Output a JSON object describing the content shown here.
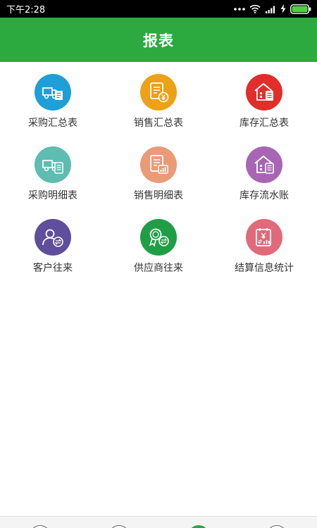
{
  "status_bar": {
    "time": "下午2:28",
    "icons": [
      "more-dots-icon",
      "wifi-icon",
      "signal-icon",
      "charging-icon",
      "battery-icon"
    ]
  },
  "header": {
    "title": "报表"
  },
  "tiles": [
    {
      "label": "采购汇总表",
      "icon": "purchase-summary-icon",
      "color": "#1e9fd8"
    },
    {
      "label": "销售汇总表",
      "icon": "sales-summary-icon",
      "color": "#eda116"
    },
    {
      "label": "库存汇总表",
      "icon": "inventory-summary-icon",
      "color": "#e12e2a"
    },
    {
      "label": "采购明细表",
      "icon": "purchase-detail-icon",
      "color": "#5dbdb0"
    },
    {
      "label": "销售明细表",
      "icon": "sales-detail-icon",
      "color": "#eb9a78"
    },
    {
      "label": "库存流水账",
      "icon": "inventory-ledger-icon",
      "color": "#a765b4"
    },
    {
      "label": "客户往来",
      "icon": "customer-transactions-icon",
      "color": "#5f4e9c"
    },
    {
      "label": "供应商往来",
      "icon": "supplier-transactions-icon",
      "color": "#1f9e45"
    },
    {
      "label": "结算信息统计",
      "icon": "settlement-stats-icon",
      "color": "#e06a7a"
    }
  ],
  "colors": {
    "header_bg": "#2caa3f",
    "status_bg": "#000000",
    "nav_active": "#2caa3f"
  },
  "bottom_nav": {
    "items": [
      "nav-tab-1",
      "nav-tab-2",
      "nav-tab-3",
      "nav-tab-4"
    ],
    "active_index": 2
  }
}
